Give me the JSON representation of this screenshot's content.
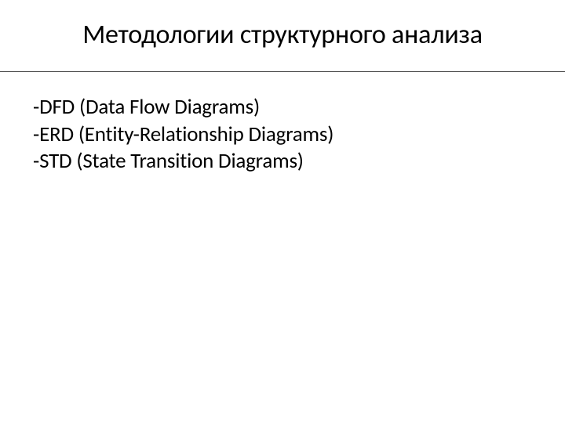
{
  "title": "Методологии структурного анализа",
  "items": [
    "-DFD (Data Flow Diagrams)",
    "-ERD (Entity-Relationship Diagrams)",
    "-STD (State Transition Diagrams)"
  ]
}
